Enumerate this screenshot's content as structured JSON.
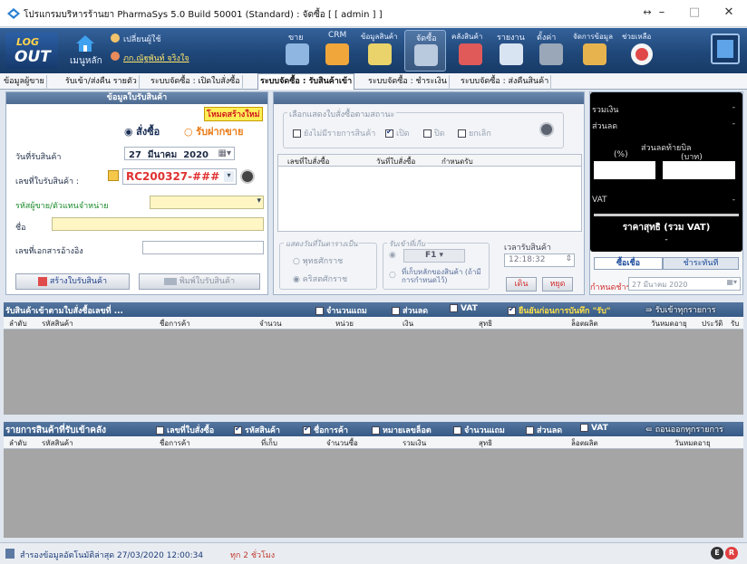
{
  "window": {
    "title": "โปรแกรมบริหารร้านยา PharmaSys 5.0 Build 50001 (Standard) : จัดซื้อ [ [ admin ] ]",
    "resize_glyph": "↔",
    "min_glyph": "–",
    "max_glyph": "□",
    "close_glyph": "✕"
  },
  "ribbon": {
    "logo_top": "LOG",
    "logo_bottom": "OUT",
    "home": "เมนูหลัก",
    "change_user": "เปลี่ยนผู้ใช้",
    "current_user": "ภก.ณัฐพันท์ จริงใจ",
    "items": [
      {
        "label": "ขาย"
      },
      {
        "label": "CRM"
      },
      {
        "label": "ข้อมูลสินค้า"
      },
      {
        "label": "จัดซื้อ"
      },
      {
        "label": "คลังสินค้า"
      },
      {
        "label": "รายงาน"
      },
      {
        "label": "ตั้งค่า"
      },
      {
        "label": "จัดการข้อมูล"
      },
      {
        "label": "ช่วยเหลือ"
      }
    ]
  },
  "tabs": [
    "ข้อมูลผู้ขาย",
    "รับเข้า/ส่งคืน รายตัว",
    "ระบบจัดซื้อ : เปิดใบสั่งซื้อ",
    "ระบบจัดซื้อ : รับสินค้าเข้า",
    "ระบบจัดซื้อ : ชำระเงิน",
    "ระบบจัดซื้อ : ส่งคืนสินค้า"
  ],
  "left": {
    "header": "ข้อมูลใบรับสินค้า",
    "mode_badge": "โหมดสร้างใหม่",
    "radio_purchase": "สั่งซื้อ",
    "radio_consign": "รับฝากขาย",
    "date_label": "วันที่รับสินค้า",
    "date_day": "27",
    "date_month": "มีนาคม",
    "date_year": "2020",
    "doc_label": "เลขที่ใบรับสินค้า :",
    "doc_value": "RC200327-###",
    "vendor_label": "รหัสผู้ขาย/ตัวแทนจำหน่าย",
    "name_label": "ชื่อ",
    "ref_label": "เลขที่เอกสารอ้างอิง",
    "create_btn": "สร้างใบรับสินค้า",
    "print_btn": "พิมพ์ใบรับสินค้า"
  },
  "mid": {
    "filter_legend": "เลือกแสดงใบสั่งซื้อตามสถานะ",
    "f_no_items": "ยังไม่มีรายการสินค้า",
    "f_open": "เปิด",
    "f_closed": "ปิด",
    "f_cancel": "ยกเลิก",
    "col_po": "เลขที่ใบสั่งซื้อ",
    "col_date": "วันที่ใบสั่งซื้อ",
    "col_due": "กำหนดรับ",
    "date_legend": "แสดงวันที่ในตารางเป็น",
    "buddhist": "พุทธศักราช",
    "christian": "คริสตศักราช",
    "store_legend": "รับเข้าที่เก็บ",
    "store_value": "F1",
    "store_note": "ที่เก็บหลักของสินค้า (ถ้ามีการกำหนดไว้)",
    "time_label": "เวลารับสินค้า",
    "time_value": "12:18:32",
    "go_btn": "เดิน",
    "stop_btn": "หยุด"
  },
  "right": {
    "total": "รวมเงิน",
    "total_val": "-",
    "discount": "ส่วนลด",
    "discount_val": "-",
    "bill_discount": "ส่วนลดท้ายบิล",
    "pct": "(%)",
    "baht": "(บาท)",
    "vat": "VAT",
    "vat_val": "-",
    "net": "ราคาสุทธิ (รวม VAT)",
    "net_val": "-",
    "tab_credit": "ซื้อเชื่อ",
    "tab_cash": "ชำระทันที",
    "due_label": "กำหนดชำระ",
    "due_value": "27  มีนาคม  2020"
  },
  "sec1": {
    "title": "รับสินค้าเข้าตามใบสั่งซื้อเลขที่  ...",
    "chk_free": "จำนวนแถม",
    "chk_disc": "ส่วนลด",
    "chk_vat": "VAT",
    "chk_confirm": "ยืนยันก่อนการบันทึก \"รับ\"",
    "btn_all": "รับเข้าทุกรายการ",
    "cols": [
      "ลำดับ",
      "รหัสสินค้า",
      "ชื่อการค้า",
      "จำนวน",
      "หน่วย",
      "เงิน",
      "สุทธิ",
      "ล็อตผลิต",
      "วันหมดอายุ",
      "ประวัติ",
      "รับ"
    ]
  },
  "sec2": {
    "title": "รายการสินค้าที่รับเข้าคลัง",
    "chk_po": "เลขที่ใบสั่งซื้อ",
    "chk_code": "รหัสสินค้า",
    "chk_name": "ชื่อการค้า",
    "chk_lot": "หมายเลขล็อต",
    "chk_free": "จำนวนแถม",
    "chk_disc": "ส่วนลด",
    "chk_vat": "VAT",
    "btn_all": "ถอนออกทุกรายการ",
    "cols": [
      "ลำดับ",
      "รหัสสินค้า",
      "ชื่อการค้า",
      "ที่เก็บ",
      "จำนวนซื้อ",
      "รวมเงิน",
      "สุทธิ",
      "ล็อตผลิต",
      "วันหมดอายุ"
    ]
  },
  "status": {
    "text": "สำรองข้อมูลอัตโนมัติล่าสุด  27/03/2020 12:00:34",
    "ago": "ทุก 2 ชั่วโมง"
  }
}
